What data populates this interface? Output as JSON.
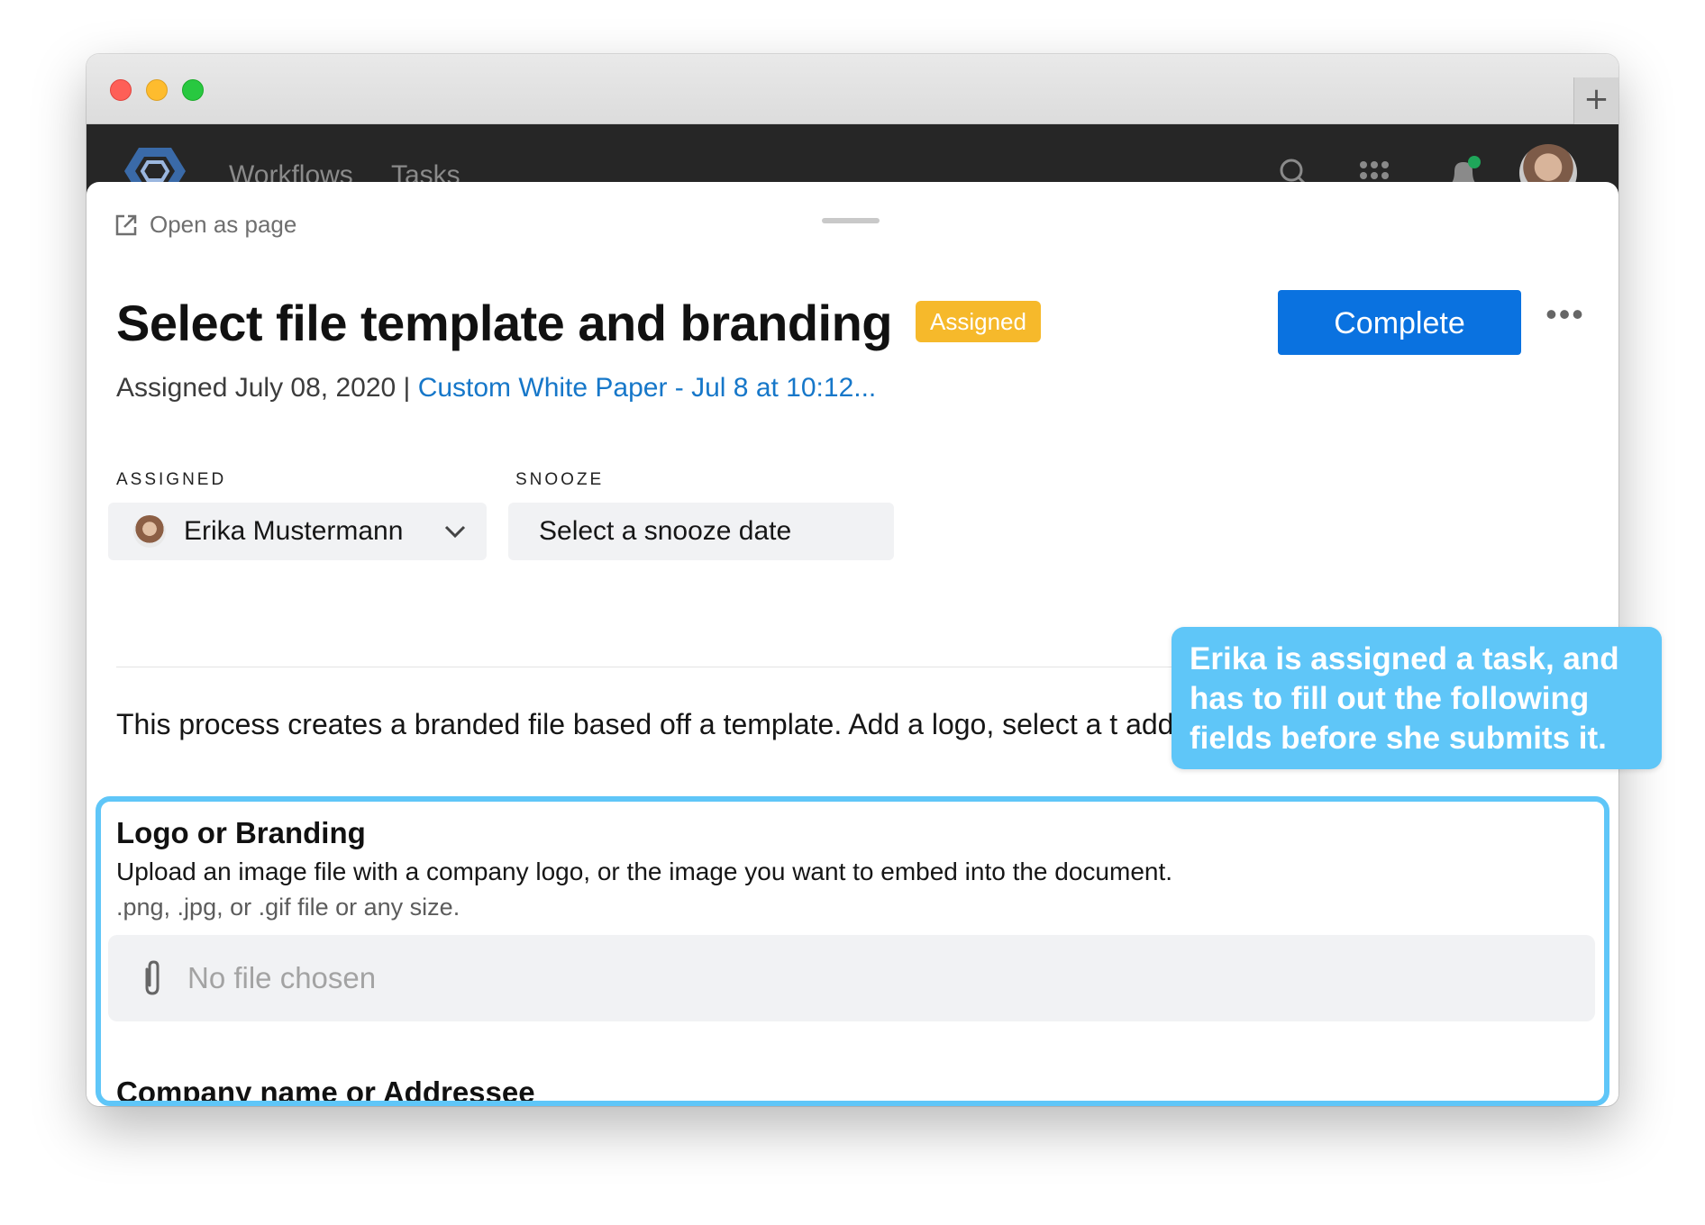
{
  "window": {
    "new_tab_glyph": "+"
  },
  "nav": {
    "logo_icon": "hexagon-logo-icon",
    "links": [
      "Workflows",
      "Tasks"
    ],
    "icons": [
      "search-icon",
      "apps-grid-icon",
      "notification-bell-icon",
      "avatar"
    ]
  },
  "panel": {
    "open_as_page": "Open as page",
    "title": "Select file template and branding",
    "status": "Assigned",
    "complete_label": "Complete",
    "more_label": "•••",
    "assigned_text": "Assigned July 08, 2020 | ",
    "workflow_link": "Custom White Paper - Jul 8 at 10:12...",
    "fields": {
      "assigned_label": "ASSIGNED",
      "assignee_name": "Erika Mustermann",
      "snooze_label": "SNOOZE",
      "snooze_placeholder": "Select a snooze date"
    },
    "description": "This process creates a branded file based off a template. Add a logo, select a t addressee.",
    "form": {
      "logo_title": "Logo or Branding",
      "logo_desc": "Upload an image file with a company logo, or the image you want to embed into the document.",
      "logo_hint": ".png, .jpg, or .gif file or any size.",
      "file_placeholder": "No file chosen",
      "company_title": "Company name or Addressee"
    }
  },
  "callout": {
    "text": "Erika is assigned a task, and has to fill out the following fields before she submits it."
  },
  "colors": {
    "primary": "#0a72e0",
    "status": "#f6b92b",
    "link": "#1677c9",
    "highlight": "#5fc6f8",
    "nav_bg": "#262626"
  }
}
